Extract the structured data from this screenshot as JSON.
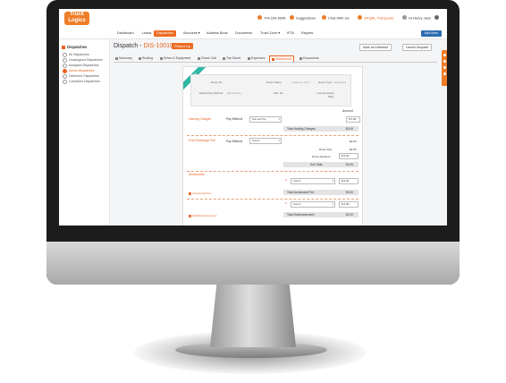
{
  "topbar": {
    "logo_line1": "Truck",
    "logo_line2": "Logics",
    "phone": "704.234.6946",
    "suggestions": "Suggestions",
    "chat": "Chat With Us",
    "transports": "SPQRL Transports",
    "user": "Hi Henry Jack"
  },
  "nav": {
    "items": [
      "Dashboard",
      "Leads",
      "Dispatches",
      "Accounts ▾",
      "Address Book",
      "Documents",
      "Truck Zone ▾",
      "IFTA",
      "Reports"
    ],
    "add_new": "Add New"
  },
  "sidebar": {
    "heading": "Dispatches",
    "items": [
      "All Dispatches",
      "Unassigned Dispatches",
      "Assigned Dispatches",
      "Active Dispatches",
      "Delivered Dispatches",
      "Cancelled Dispatches"
    ]
  },
  "page": {
    "title_prefix": "Dispatch - ",
    "dispatch_id": "DIS-10010",
    "status": "Picked Up",
    "mark_delivered": "Mark as Delivered",
    "cancel_dispatch": "Cancel Dispatch"
  },
  "tabs": [
    "Summary",
    "Routing",
    "Driver & Equipment",
    "Check Call",
    "Trip Sheet",
    "Expenses",
    "Settlements",
    "Documents"
  ],
  "settlement": {
    "ribbon": "NEW",
    "info": {
      "driver_id_label": "Driver ID:",
      "driver_name_label": "Driver Name:",
      "driver_name_value": "Lawrence Jerry",
      "driver_type_label": "Driver Type:",
      "driver_type_value": "Employee",
      "default_pay_label": "Default Pay Method:",
      "default_pay_value": "Manual Pay",
      "cdl_label": "CDL No:",
      "license_label": "License Expiry Date:"
    },
    "amount_header": "Amount",
    "hauling_label": "Hauling Charges",
    "pay_method_label": "Pay Method",
    "pay_method_value": "Manual Pay",
    "hauling_amount": "0.00",
    "total_hauling_label": "Total Hauling Charges:",
    "total_hauling_value": "$0.00",
    "fuel_label": "Fuel Surcharge Fee",
    "pay_method2_label": "Pay Method",
    "pay_method2_value": "Select",
    "fuel_value": "$0.00",
    "driver_pay_label": "Driver Pay:",
    "driver_pay_value": "$0.00",
    "driver_advance_label": "Driver Advance:",
    "driver_advance_amount": "0.00",
    "subtotal_label": "Sub Total:",
    "subtotal_value": "$0.00",
    "accessorial_label": "Accessorial",
    "accessorial_select": "Select",
    "accessorial_amount": "0.00",
    "add_accessorial": "Accessorial Fee",
    "total_accessorial_label": "Total Accessorial Fee:",
    "total_accessorial_value": "$0.00",
    "reimb_select": "Select",
    "reimb_amount": "0.00",
    "add_reimb": "Add Reimbursement",
    "total_reimb_label": "Total Reimbursement:",
    "total_reimb_value": "$0.00",
    "currency": "$"
  }
}
